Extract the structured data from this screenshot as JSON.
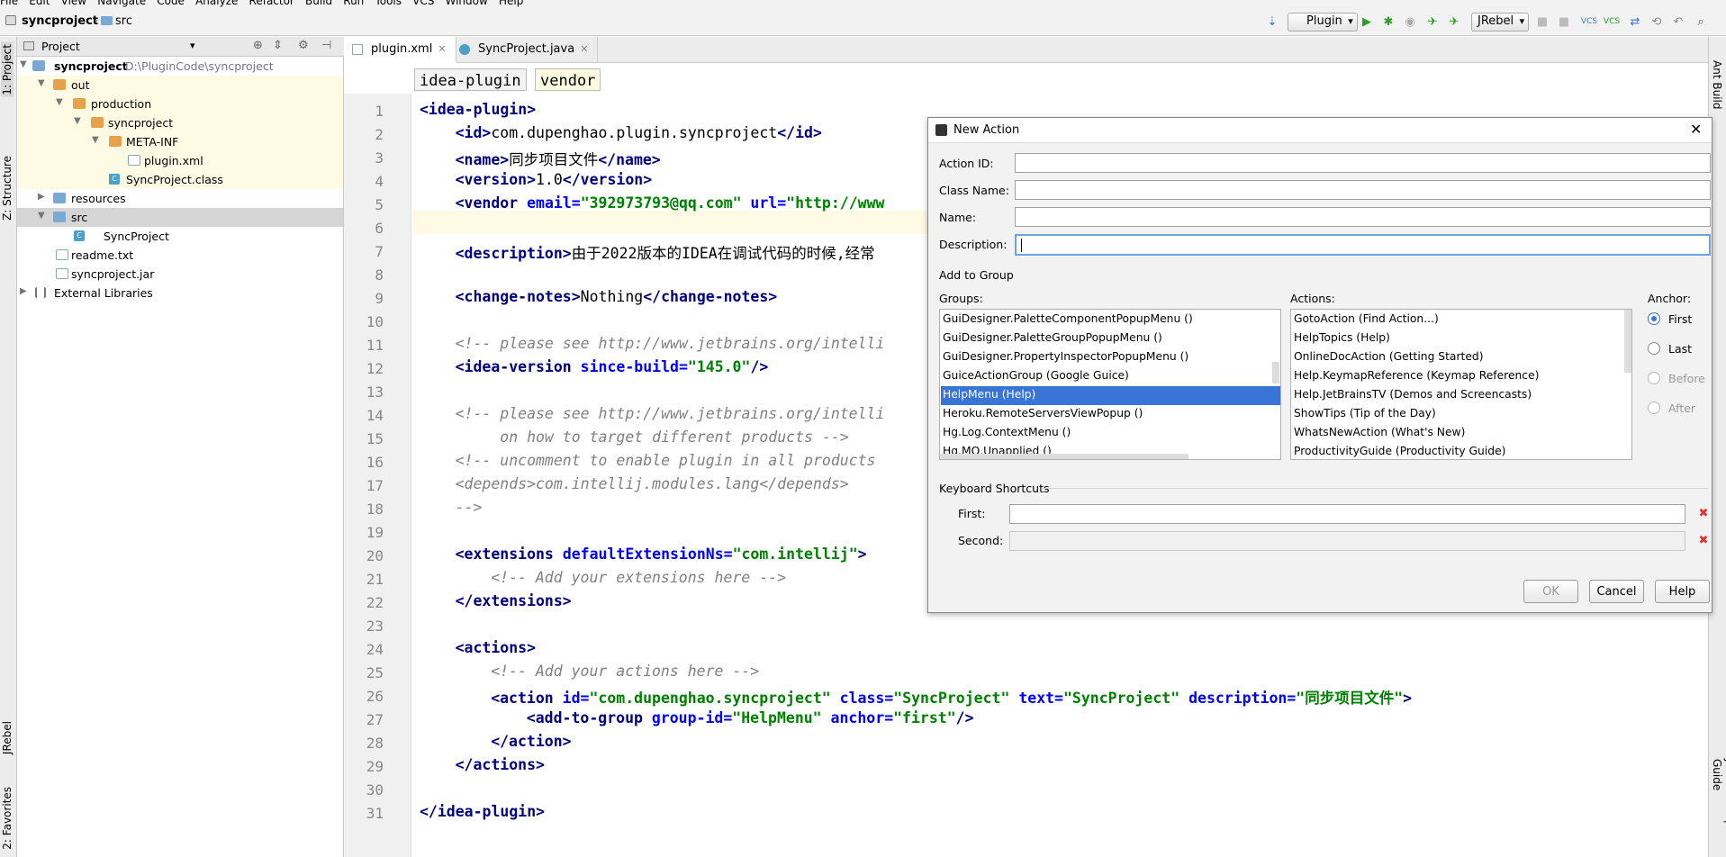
{
  "menubar": [
    "File",
    "Edit",
    "View",
    "Navigate",
    "Code",
    "Analyze",
    "Refactor",
    "Build",
    "Run",
    "Tools",
    "VCS",
    "Window",
    "Help"
  ],
  "breadcrumb": {
    "project": "syncproject",
    "folder": "src"
  },
  "toolbar": {
    "run_config": "Plugin",
    "jrebel": "JRebel"
  },
  "left_tabs": {
    "project": "1: Project",
    "structure": "Z: Structure",
    "jrebel": "JRebel",
    "favorites": "2: Favorites"
  },
  "right_tabs": {
    "ant": "Ant Build",
    "jrebel_setup": "JRebel Setup Guide"
  },
  "project_panel": {
    "title": "Project",
    "tree": [
      {
        "label": "syncproject",
        "path": "D:\\PluginCode\\syncproject"
      },
      {
        "label": "out"
      },
      {
        "label": "production"
      },
      {
        "label": "syncproject"
      },
      {
        "label": "META-INF"
      },
      {
        "label": "plugin.xml"
      },
      {
        "label": "SyncProject.class"
      },
      {
        "label": "resources"
      },
      {
        "label": "src"
      },
      {
        "label": "SyncProject"
      },
      {
        "label": "readme.txt"
      },
      {
        "label": "syncproject.jar"
      },
      {
        "label": "External Libraries"
      }
    ]
  },
  "editor": {
    "tabs": [
      "plugin.xml",
      "SyncProject.java"
    ],
    "xml_crumbs": [
      "idea-plugin",
      "vendor"
    ],
    "line_numbers": [
      "1",
      "2",
      "3",
      "4",
      "5",
      "6",
      "7",
      "8",
      "9",
      "10",
      "11",
      "12",
      "13",
      "14",
      "15",
      "16",
      "17",
      "18",
      "19",
      "20",
      "21",
      "22",
      "23",
      "24",
      "25",
      "26",
      "27",
      "28",
      "29",
      "30",
      "31"
    ],
    "lines": {
      "l2_tag_open": "<id>",
      "l2_text": "com.dupenghao.plugin.syncproject",
      "l2_tag_close": "</id>",
      "l3_tag_open": "<name>",
      "l3_text": "同步项目文件",
      "l3_tag_close": "</name>",
      "l4_tag_open": "<version>",
      "l4_text": "1.0",
      "l4_tag_close": "</version>",
      "l5_tag": "<vendor ",
      "l5_a1": "email=",
      "l5_v1": "\"392973793@qq.com\"",
      "l5_a2": " url=",
      "l5_v2": "\"http://www",
      "l7_tag": "<description>",
      "l7_text": "由于2022版本的IDEA在调试代码的时候,经常",
      "l9_tag_open": "<change-notes>",
      "l9_text": "Nothing",
      "l9_tag_close": "</change-notes>",
      "l11": "<!-- please see http://www.jetbrains.org/intelli",
      "l12_tag": "<idea-version ",
      "l12_attr": "since-build=",
      "l12_val": "\"145.0\"",
      "l12_end": "/>",
      "l14": "<!-- please see http://www.jetbrains.org/intelli",
      "l15": "     on how to target different products -->",
      "l16": "<!-- uncomment to enable plugin in all products",
      "l17": "<depends>com.intellij.modules.lang</depends>",
      "l18": "-->",
      "l20_tag": "<extensions ",
      "l20_attr": "defaultExtensionNs=",
      "l20_val": "\"com.intellij\"",
      "l20_end": ">",
      "l21": "<!-- Add your extensions here -->",
      "l22": "</extensions>",
      "l24": "<actions>",
      "l25": "<!-- Add your actions here -->",
      "l26_tag": "<action ",
      "l26_a1": "id=",
      "l26_v1": "\"com.dupenghao.syncproject\"",
      "l26_a2": " class=",
      "l26_v2": "\"SyncProject\"",
      "l26_a3": " text=",
      "l26_v3": "\"SyncProject\"",
      "l26_a4": " description=",
      "l26_v4": "\"同步项目文件\"",
      "l26_end": ">",
      "l27_tag": "<add-to-group ",
      "l27_a1": "group-id=",
      "l27_v1": "\"HelpMenu\"",
      "l27_a2": " anchor=",
      "l27_v2": "\"first\"",
      "l27_end": "/>",
      "l28": "</action>",
      "l29": "</actions>",
      "l31": "</idea-plugin>",
      "l1": "<idea-plugin>"
    }
  },
  "dialog": {
    "title": "New Action",
    "action_id_label": "Action ID:",
    "class_name_label": "Class Name:",
    "name_label": "Name:",
    "description_label": "Description:",
    "add_to_group": "Add to Group",
    "groups_label": "Groups:",
    "actions_label": "Actions:",
    "anchor_label": "Anchor:",
    "groups": [
      "GuiDesigner.PaletteComponentPopupMenu ()",
      "GuiDesigner.PaletteGroupPopupMenu ()",
      "GuiDesigner.PropertyInspectorPopupMenu ()",
      "GuiceActionGroup (Google Guice)",
      "HelpMenu (Help)",
      "Heroku.RemoteServersViewPopup ()",
      "Hg.Log.ContextMenu ()",
      "Hg.MQ.Unapplied ()"
    ],
    "selected_group": "HelpMenu (Help)",
    "actions": [
      "GotoAction (Find Action...)",
      "HelpTopics (Help)",
      "OnlineDocAction (Getting Started)",
      "Help.KeymapReference (Keymap Reference)",
      "Help.JetBrainsTV (Demos and Screencasts)",
      "ShowTips (Tip of the Day)",
      "WhatsNewAction (What's New)",
      "ProductivityGuide (Productivity Guide)"
    ],
    "anchors": [
      "First",
      "Last",
      "Before",
      "After"
    ],
    "selected_anchor": "First",
    "keyboard_shortcuts": "Keyboard Shortcuts",
    "first_label": "First:",
    "second_label": "Second:",
    "ok": "OK",
    "cancel": "Cancel",
    "help": "Help"
  }
}
